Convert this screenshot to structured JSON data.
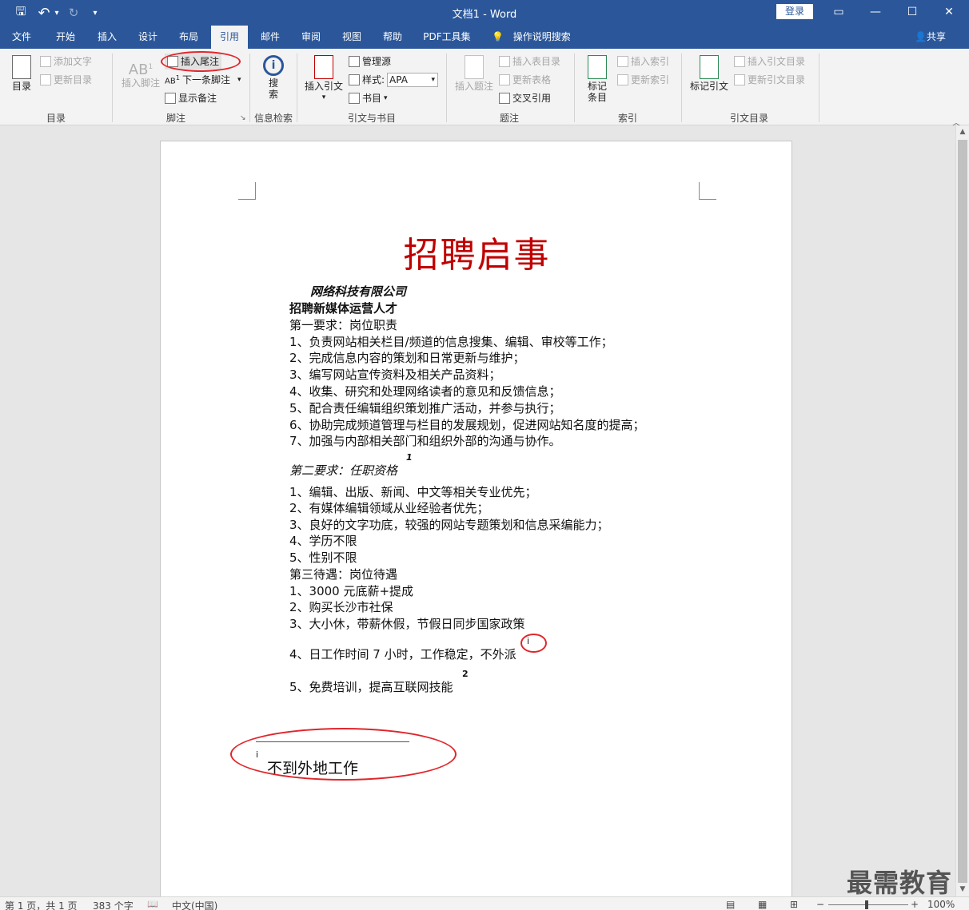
{
  "window": {
    "title": "文档1  -  Word",
    "login_label": "登录",
    "min_glyph": "—",
    "max_glyph": "☐",
    "close_glyph": "✕",
    "ribbon_display_glyph": "▭"
  },
  "quick_access": {
    "save_glyph": "🖫",
    "undo_glyph": "↶",
    "undo_menu_glyph": "▾",
    "redo_glyph": "↻",
    "customize_glyph": "▾"
  },
  "tabs": [
    "文件",
    "开始",
    "插入",
    "设计",
    "布局",
    "引用",
    "邮件",
    "审阅",
    "视图",
    "帮助",
    "PDF工具集"
  ],
  "active_tab": "引用",
  "tell_me": "操作说明搜索",
  "share_label": "共享",
  "ribbon": {
    "toc": {
      "big_label": "目录",
      "add_text": "添加文字",
      "update_toc": "更新目录",
      "group": "目录"
    },
    "footnotes": {
      "insert_footnote": "插入脚注",
      "insert_endnote": "插入尾注",
      "next_footnote": "下一条脚注",
      "show_notes": "显示备注",
      "group": "脚注",
      "ab_glyph": "AB",
      "ab_sup": "1",
      "ab_small": "AB",
      "ab_small_sup": "1"
    },
    "research": {
      "search_label": "搜索",
      "group": "信息检索",
      "search_glyph": "i"
    },
    "citations": {
      "insert_citation": "插入引文",
      "manage_sources": "管理源",
      "style_label": "样式:",
      "style_value": "APA",
      "bibliography": "书目",
      "group": "引文与书目"
    },
    "captions": {
      "insert_caption": "插入题注",
      "insert_table_of_figures": "插入表目录",
      "update_table": "更新表格",
      "cross_reference": "交叉引用",
      "group": "题注"
    },
    "index": {
      "mark_entry": "标记条目",
      "insert_index": "插入索引",
      "update_index": "更新索引",
      "group": "索引"
    },
    "toa": {
      "mark_citation": "标记引文",
      "insert_toa": "插入引文目录",
      "update_toa": "更新引文目录",
      "group": "引文目录"
    },
    "collapse_glyph": "︿"
  },
  "document": {
    "title": "招聘启事",
    "company": "网络科技有限公司",
    "position": "招聘新媒体运营人才",
    "section1_title": "第一要求：岗位职责",
    "section1_items": [
      "1、负责网站相关栏目/频道的信息搜集、编辑、审校等工作；",
      "2、完成信息内容的策划和日常更新与维护；",
      "3、编写网站宣传资料及相关产品资料；",
      "4、收集、研究和处理网络读者的意见和反馈信息；",
      "5、配合责任编辑组织策划推广活动，并参与执行；",
      "6、协助完成频道管理与栏目的发展规划，促进网站知名度的提高；",
      "7、加强与内部相关部门和组织外部的沟通与协作。"
    ],
    "footnote_ref1": "1",
    "section2_title": "第二要求：任职资格",
    "section2_items": [
      "1、编辑、出版、新闻、中文等相关专业优先；",
      "2、有媒体编辑领域从业经验者优先；",
      "3、良好的文字功底，较强的网站专题策划和信息采编能力；",
      "4、学历不限",
      "5、性别不限"
    ],
    "section3_title": "第三待遇：岗位待遇",
    "section3_items": [
      "1、3000 元底薪+提成",
      "2、购买长沙市社保",
      "3、大小休，带薪休假，节假日同步国家政策",
      "4、日工作时间 7 小时，工作稳定，不外派",
      "5、免费培训，提高互联网技能"
    ],
    "endnote_ref": "i",
    "footnote_ref2": "2",
    "endnote_mark": "i",
    "endnote_text": "不到外地工作"
  },
  "scrollbar": {
    "up_glyph": "▲",
    "down_glyph": "▼"
  },
  "watermark": "最需教育",
  "statusbar": {
    "page_info": "第 1 页，共 1 页",
    "word_count": "383 个字",
    "proof_glyph": "📖",
    "language": "中文(中国)",
    "read_mode_glyph": "▤",
    "print_layout_glyph": "▦",
    "web_layout_glyph": "⊞",
    "zoom_minus": "−",
    "zoom_plus": "+",
    "zoom": "100%"
  },
  "colors": {
    "accent": "#2b579a",
    "title_red": "#c00000",
    "annotation_red": "#e0262b"
  }
}
